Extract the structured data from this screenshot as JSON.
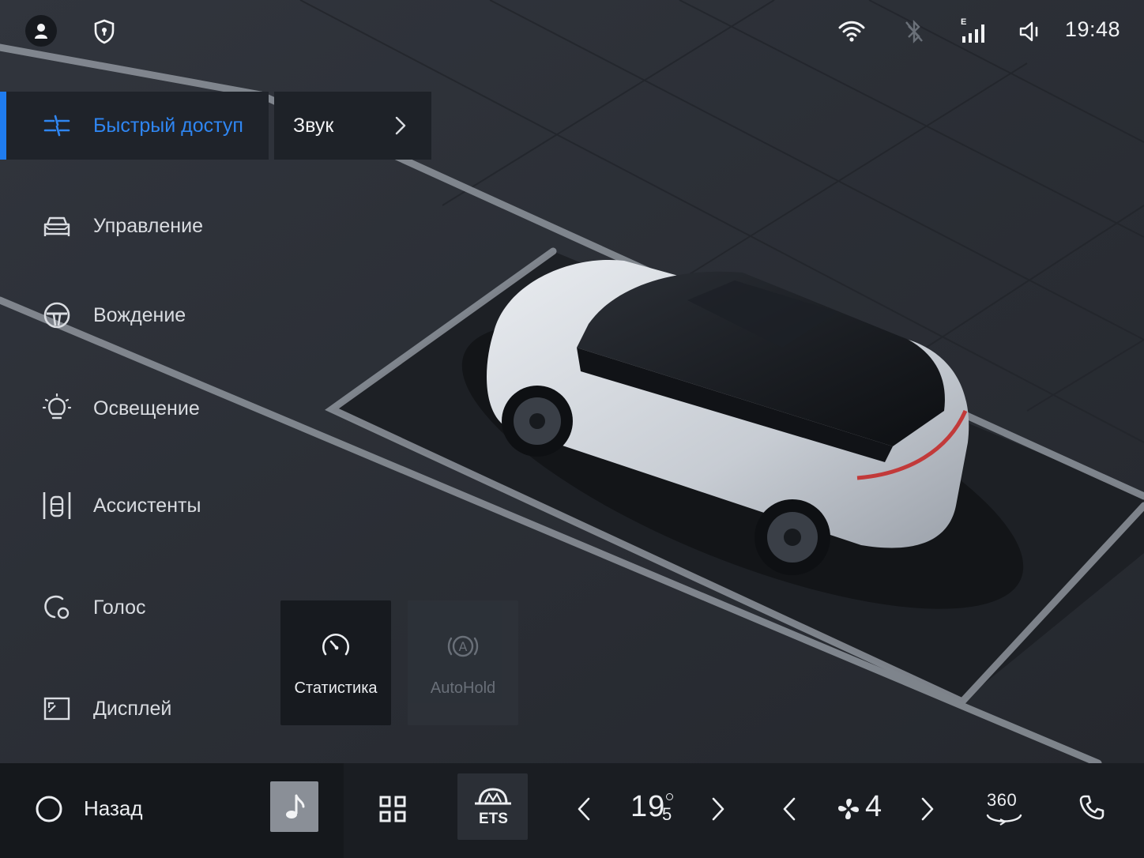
{
  "status_bar": {
    "time": "19:48",
    "icons": [
      "user-icon",
      "shield-icon",
      "wifi-icon",
      "bluetooth-icon",
      "signal-icon",
      "volume-icon"
    ],
    "signal_label": "E"
  },
  "sidebar": {
    "items": [
      {
        "label": "Быстрый доступ",
        "icon": "quick-access-icon",
        "active": true
      },
      {
        "label": "Управление",
        "icon": "car-front-icon",
        "active": false
      },
      {
        "label": "Вождение",
        "icon": "steering-wheel-icon",
        "active": false
      },
      {
        "label": "Освещение",
        "icon": "light-bulb-icon",
        "active": false
      },
      {
        "label": "Ассистенты",
        "icon": "assistants-icon",
        "active": false
      },
      {
        "label": "Голос",
        "icon": "voice-icon",
        "active": false
      },
      {
        "label": "Дисплей",
        "icon": "display-icon",
        "active": false
      }
    ]
  },
  "submenu": {
    "label": "Звук",
    "icon": "chevron-right-icon"
  },
  "tiles": [
    {
      "label": "Статистика",
      "icon": "speedometer-icon",
      "enabled": true
    },
    {
      "label": "AutoHold",
      "icon": "autohold-icon",
      "enabled": false
    }
  ],
  "dock": {
    "back_label": "Назад",
    "ets_label": "ETS",
    "temperature": {
      "whole": "19",
      "decimal": "5"
    },
    "fan_level": "4",
    "camera_label": "360",
    "icons": [
      "home-circle-icon",
      "music-note-icon",
      "apps-grid-icon",
      "ets-icon",
      "chevron-left-icon",
      "chevron-right-icon",
      "fan-icon",
      "camera-360-icon",
      "phone-icon"
    ]
  },
  "colors": {
    "accent": "#1f7cf0",
    "background": "#2a2e35",
    "panel": "#1e2228",
    "dock": "#1a1d22"
  }
}
